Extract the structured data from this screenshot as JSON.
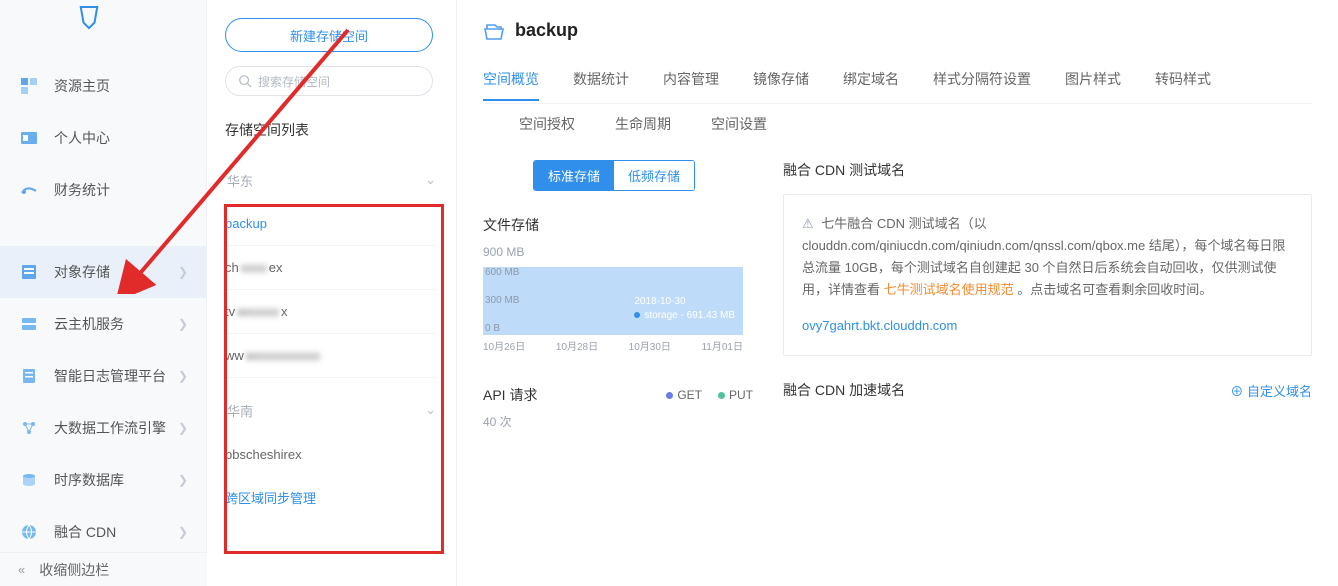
{
  "sidebar": {
    "items": [
      {
        "label": "资源主页",
        "icon": "home"
      },
      {
        "label": "个人中心",
        "icon": "user"
      },
      {
        "label": "财务统计",
        "icon": "finance"
      }
    ],
    "items2": [
      {
        "label": "对象存储",
        "icon": "storage",
        "active": true
      },
      {
        "label": "云主机服务",
        "icon": "server"
      },
      {
        "label": "智能日志管理平台",
        "icon": "log"
      },
      {
        "label": "大数据工作流引擎",
        "icon": "bigdata"
      },
      {
        "label": "时序数据库",
        "icon": "tsdb"
      },
      {
        "label": "融合 CDN",
        "icon": "cdn"
      }
    ],
    "collapse": "收缩侧边栏"
  },
  "bucketPanel": {
    "newButton": "新建存储空间",
    "searchPlaceholder": "搜索存储空间",
    "listTitle": "存储空间列表",
    "regions": [
      {
        "name": "华东",
        "buckets": [
          {
            "name": "backup",
            "active": true
          },
          {
            "name": "ch",
            "obscured": "ex"
          },
          {
            "name": "tv",
            "obscured": "x"
          },
          {
            "name": "ww",
            "obscured": ""
          }
        ]
      },
      {
        "name": "华南",
        "buckets": [
          {
            "name": "bbscheshirex"
          }
        ]
      }
    ],
    "crossRegion": "跨区域同步管理"
  },
  "main": {
    "bucketName": "backup",
    "tabs": [
      "空间概览",
      "数据统计",
      "内容管理",
      "镜像存储",
      "绑定域名",
      "样式分隔符设置",
      "图片样式",
      "转码样式"
    ],
    "tabs2": [
      "空间授权",
      "生命周期",
      "空间设置"
    ],
    "activeTab": 0,
    "storageToggle": {
      "opt1": "标准存储",
      "opt2": "低频存储"
    },
    "fileStorage": {
      "title": "文件存储",
      "currentLabel": "900 MB"
    },
    "apiRequests": {
      "title": "API 请求",
      "count": "40 次",
      "legend": {
        "get": "GET",
        "put": "PUT"
      }
    },
    "cdnTest": {
      "title": "融合 CDN 测试域名",
      "note1": "七牛融合 CDN 测试域名（以 clouddn.com/qiniucdn.com/qiniudn.com/qnssl.com/qbox.me 结尾），每个域名每日限总流量 10GB，每个测试域名自创建起 30 个自然日后系统会自动回收，仅供测试使用，详情查看 ",
      "ruleLink": "七牛测试域名使用规范",
      "note2": " 。点击域名可查看剩余回收时间。",
      "domain": "ovy7gahrt.bkt.clouddn.com"
    },
    "cdnAccel": {
      "title": "融合 CDN 加速域名",
      "addLabel": "自定义域名"
    }
  },
  "chart_data": {
    "type": "area",
    "title": "文件存储",
    "ylabel": "MB",
    "ylim": [
      0,
      900
    ],
    "y_ticks": [
      "600 MB",
      "300 MB",
      "0 B"
    ],
    "categories": [
      "10月26日",
      "10月28日",
      "10月30日",
      "11月01日"
    ],
    "series": [
      {
        "name": "storage",
        "values": [
          691,
          691,
          691,
          691
        ]
      }
    ],
    "tooltip": {
      "date": "2018-10-30",
      "label": "storage",
      "value": "691.43 MB"
    }
  }
}
